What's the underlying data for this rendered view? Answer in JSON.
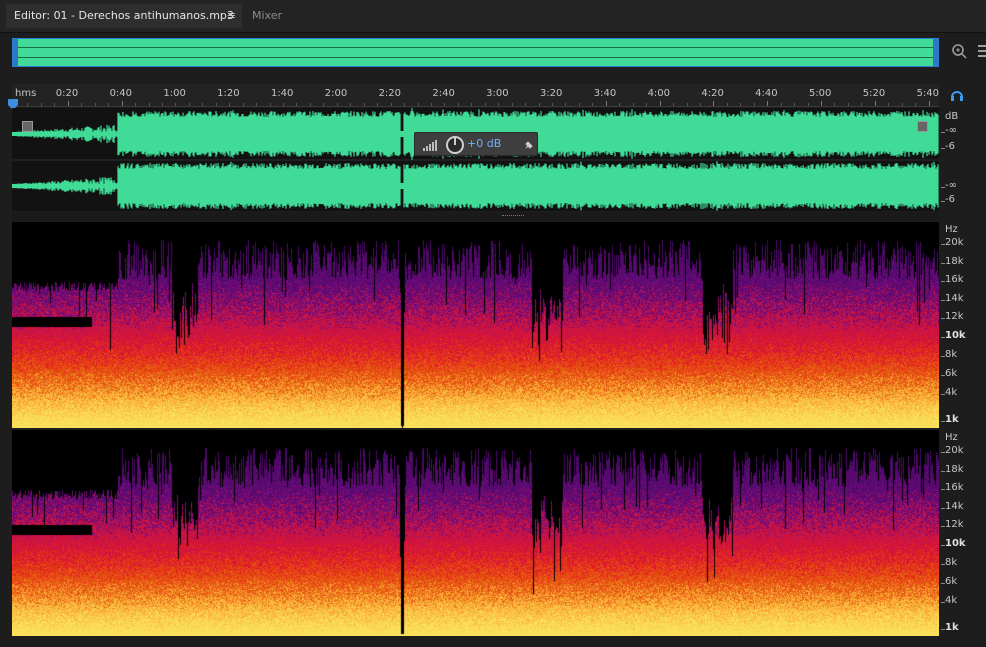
{
  "tabs": {
    "editor_label": "Editor: 01 - Derechos antihumanos.mp3",
    "editor_menu_icon": "≡",
    "mixer_label": "Mixer"
  },
  "ruler": {
    "unit_label": "hms",
    "time_labels": [
      "0:20",
      "0:40",
      "1:00",
      "1:20",
      "1:40",
      "2:00",
      "2:20",
      "2:40",
      "3:00",
      "3:20",
      "3:40",
      "4:00",
      "4:20",
      "4:40",
      "5:00",
      "5:20",
      "5:40"
    ]
  },
  "hud": {
    "gain_label": "+0 dB"
  },
  "waveform_scale": {
    "channel1": [
      "dB",
      "-∞",
      "-6"
    ],
    "channel2": [
      "-∞",
      "-6"
    ]
  },
  "spectral_scale": {
    "unit": "Hz",
    "labels": [
      "20k",
      "18k",
      "16k",
      "14k",
      "12k",
      "10k",
      "8k",
      "6k",
      "4k",
      "1k"
    ],
    "bold_labels": [
      "10k",
      "1k"
    ]
  },
  "colors": {
    "waveform": "#3fdb97",
    "accent": "#2a7fd0",
    "background": "#121212"
  },
  "icons": {
    "zoom": "zoom-in-icon",
    "monitor": "headphones-icon",
    "toolbar": "list-icon"
  }
}
